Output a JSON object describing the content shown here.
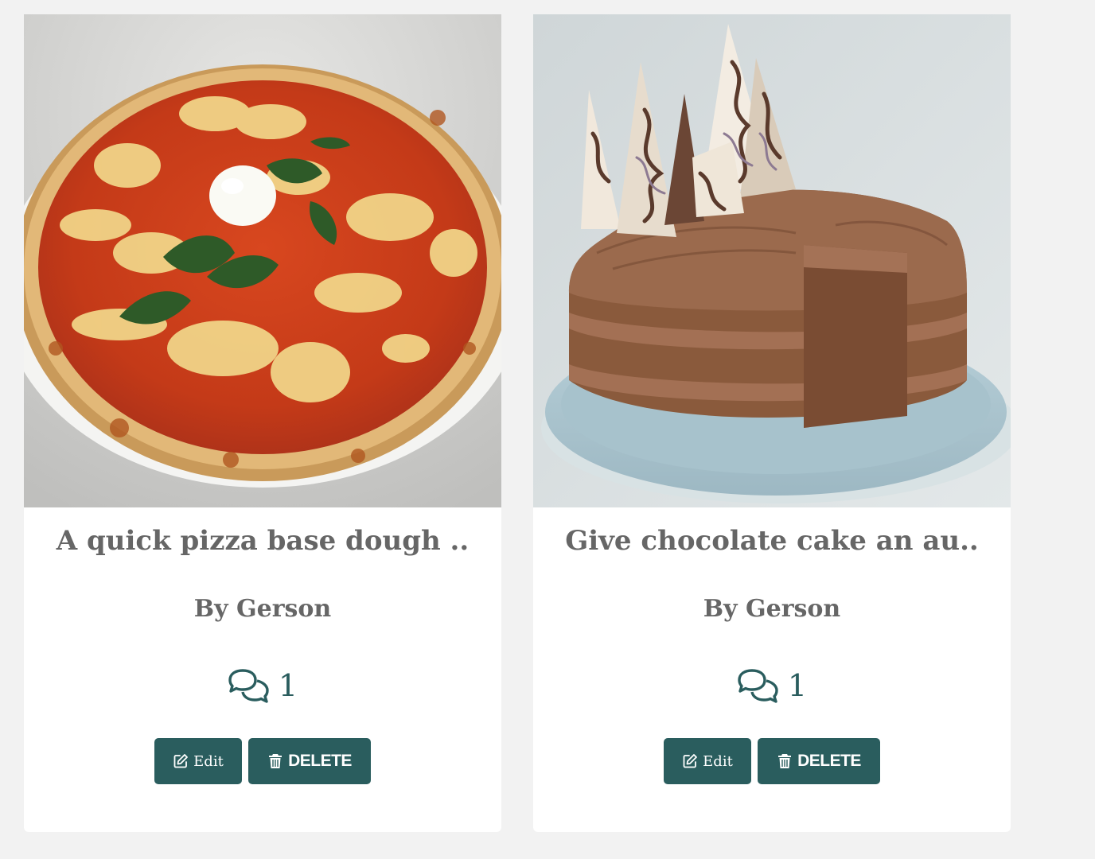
{
  "colors": {
    "accent": "#2a5d5e",
    "text_muted": "#666666",
    "background": "#f2f2f2"
  },
  "recipes": [
    {
      "title": "A quick pizza base dough ..",
      "author": "By Gerson",
      "comment_count": "1",
      "edit_label": "Edit",
      "delete_label": "DELETE",
      "image": "pizza-photo"
    },
    {
      "title": "Give chocolate cake an au..",
      "author": "By Gerson",
      "comment_count": "1",
      "edit_label": "Edit",
      "delete_label": "DELETE",
      "image": "chocolate-cake-photo"
    }
  ],
  "icons": {
    "comments": "comments-icon",
    "edit": "edit-icon",
    "delete": "trash-icon"
  }
}
